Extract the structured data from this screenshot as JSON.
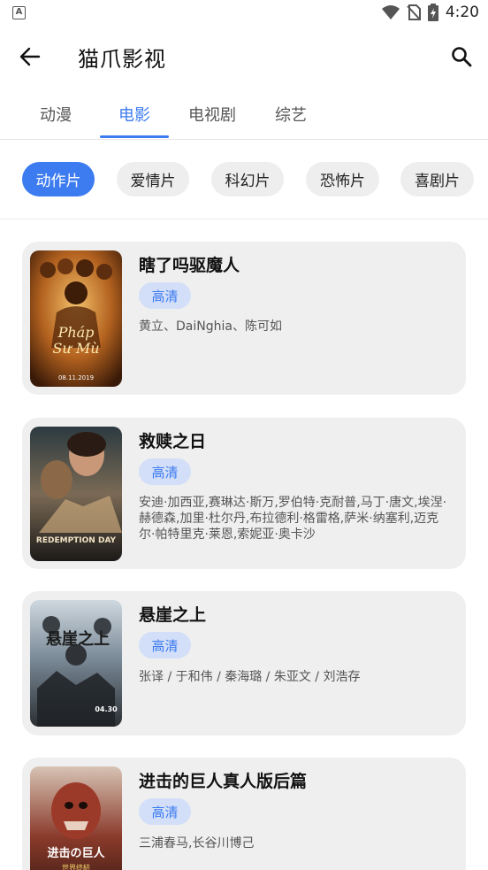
{
  "status": {
    "time": "4:20",
    "notification_icon": "A"
  },
  "app_bar": {
    "title": "猫爪影视"
  },
  "tabs": [
    {
      "label": "动漫"
    },
    {
      "label": "电影"
    },
    {
      "label": "电视剧"
    },
    {
      "label": "综艺"
    }
  ],
  "active_tab": "电影",
  "chips": [
    {
      "label": "动作片"
    },
    {
      "label": "爱情片"
    },
    {
      "label": "科幻片"
    },
    {
      "label": "恐怖片"
    },
    {
      "label": "喜剧片"
    }
  ],
  "active_chip": "动作片",
  "movies": [
    {
      "title": "瞎了吗驱魔人",
      "quality": "高清",
      "cast": "黄立、DaiNghia、陈可如",
      "poster_text": "Pháp Sư Mù",
      "poster_date": "08.11.2019"
    },
    {
      "title": "救赎之日",
      "quality": "高清",
      "cast": "安迪·加西亚,赛琳达·斯万,罗伯特·克耐普,马丁·唐文,埃涅·赫德森,加里·杜尔丹,布拉德利·格雷格,萨米·纳塞利,迈克尔·帕特里克·莱恩,索妮亚·奥卡沙",
      "poster_text": "REDEMPTION DAY"
    },
    {
      "title": "悬崖之上",
      "quality": "高清",
      "cast": "张译 / 于和伟 / 秦海璐 / 朱亚文 / 刘浩存",
      "poster_text": "悬崖之上",
      "poster_date": "04.30"
    },
    {
      "title": "进击的巨人真人版后篇",
      "quality": "高清",
      "cast": "三浦春马,长谷川博己",
      "poster_text": "进击の巨人",
      "poster_subtitle": "世界终結"
    }
  ],
  "colors": {
    "accent": "#3c7bf0",
    "card_bg": "#efefef",
    "chip_bg": "#eeeeee",
    "badge_bg": "#d3dff8"
  }
}
